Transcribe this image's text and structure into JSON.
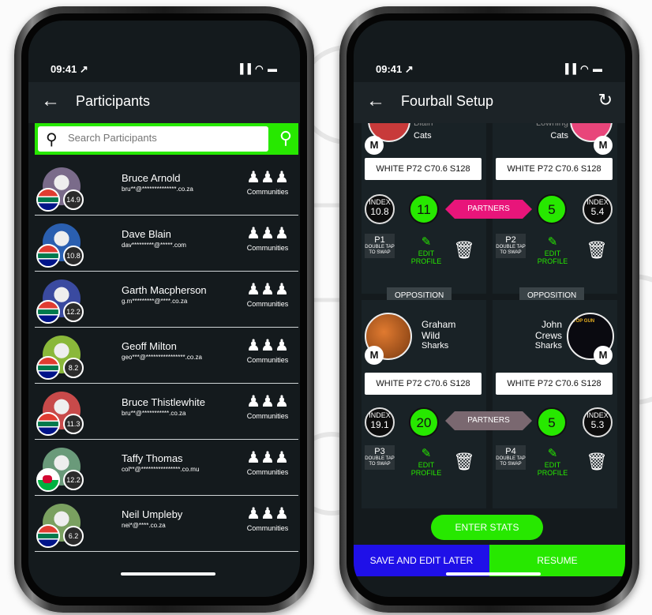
{
  "left_phone": {
    "status": {
      "time": "09:41 ↗",
      "icons": "▐▐ ◠ ▬"
    },
    "header": {
      "back": "←",
      "title": "Participants"
    },
    "search": {
      "placeholder": "Search Participants",
      "icon": "search-icon"
    },
    "participants": [
      {
        "name": "Bruce Arnold",
        "email": "bru**@**************.co.za",
        "handicap": "14.9",
        "flag": "south-africa",
        "avatar_color": "#7a6b8a",
        "communities_label": "Communities"
      },
      {
        "name": "Dave Blain",
        "email": "dav*********@*****.com",
        "handicap": "10.8",
        "flag": "south-africa",
        "avatar_color": "#2a5fb0",
        "communities_label": "Communities"
      },
      {
        "name": "Garth Macpherson",
        "email": "g.m*********@****.co.za",
        "handicap": "12.2",
        "flag": "south-africa",
        "avatar_color": "#3a4aa0",
        "communities_label": "Communities"
      },
      {
        "name": "Geoff Milton",
        "email": "geo***@****************.co.za",
        "handicap": "8.2",
        "flag": "south-africa",
        "avatar_color": "#8ab83a",
        "communities_label": "Communities"
      },
      {
        "name": "Bruce Thistlewhite",
        "email": "bru**@***********.co.za",
        "handicap": "11.3",
        "flag": "south-africa",
        "avatar_color": "#c84a4a",
        "communities_label": "Communities"
      },
      {
        "name": "Taffy Thomas",
        "email": "col**@****************.co.mu",
        "handicap": "12.2",
        "flag": "wales",
        "avatar_color": "#6a9a7a",
        "communities_label": "Communities"
      },
      {
        "name": "Neil Umpleby",
        "email": "nei*@****.co.za",
        "handicap": "6.2",
        "flag": "south-africa",
        "avatar_color": "#7aa060",
        "communities_label": "Communities"
      }
    ]
  },
  "right_phone": {
    "status": {
      "time": "09:41 ↗",
      "icons": "▐▐ ◠ ▬"
    },
    "header": {
      "back": "←",
      "title": "Fourball Setup",
      "refresh_icon": "↻"
    },
    "top_pair": {
      "partners_label": "PARTNERS",
      "partners_color": "#e8157a",
      "players": [
        {
          "first": "Blain",
          "club": "Cats",
          "m": "M",
          "tee": "WHITE  P72  C70.6  S128",
          "index_label": "INDEX",
          "index": "10.8",
          "score": "11",
          "pos": "P1",
          "swap": "DOUBLE TAP TO SWAP",
          "edit": "EDIT PROFILE"
        },
        {
          "first": "Lowning",
          "club": "Cats",
          "m": "M",
          "tee": "WHITE  P72  C70.6  S128",
          "index_label": "INDEX",
          "index": "5.4",
          "score": "5",
          "pos": "P2",
          "swap": "DOUBLE TAP TO SWAP",
          "edit": "EDIT PROFILE"
        }
      ]
    },
    "opposition_label": "OPPOSITION",
    "bottom_pair": {
      "partners_label": "PARTNERS",
      "partners_color": "#7a6870",
      "players": [
        {
          "first": "Graham",
          "last": "Wild",
          "club": "Sharks",
          "m": "M",
          "tee": "WHITE  P72  C70.6  S128",
          "index_label": "INDEX",
          "index": "19.1",
          "score": "20",
          "pos": "P3",
          "swap": "DOUBLE TAP TO SWAP",
          "edit": "EDIT PROFILE"
        },
        {
          "first": "John",
          "last": "Crews",
          "club": "Sharks",
          "m": "M",
          "tee": "WHITE  P72  C70.6  S128",
          "index_label": "INDEX",
          "index": "5.3",
          "score": "5",
          "pos": "P4",
          "swap": "DOUBLE TAP TO SWAP",
          "edit": "EDIT PROFILE",
          "avatar_text": "TOP GUN"
        }
      ]
    },
    "enter_stats": "ENTER STATS",
    "save_later": "SAVE AND EDIT LATER",
    "resume": "RESUME"
  }
}
